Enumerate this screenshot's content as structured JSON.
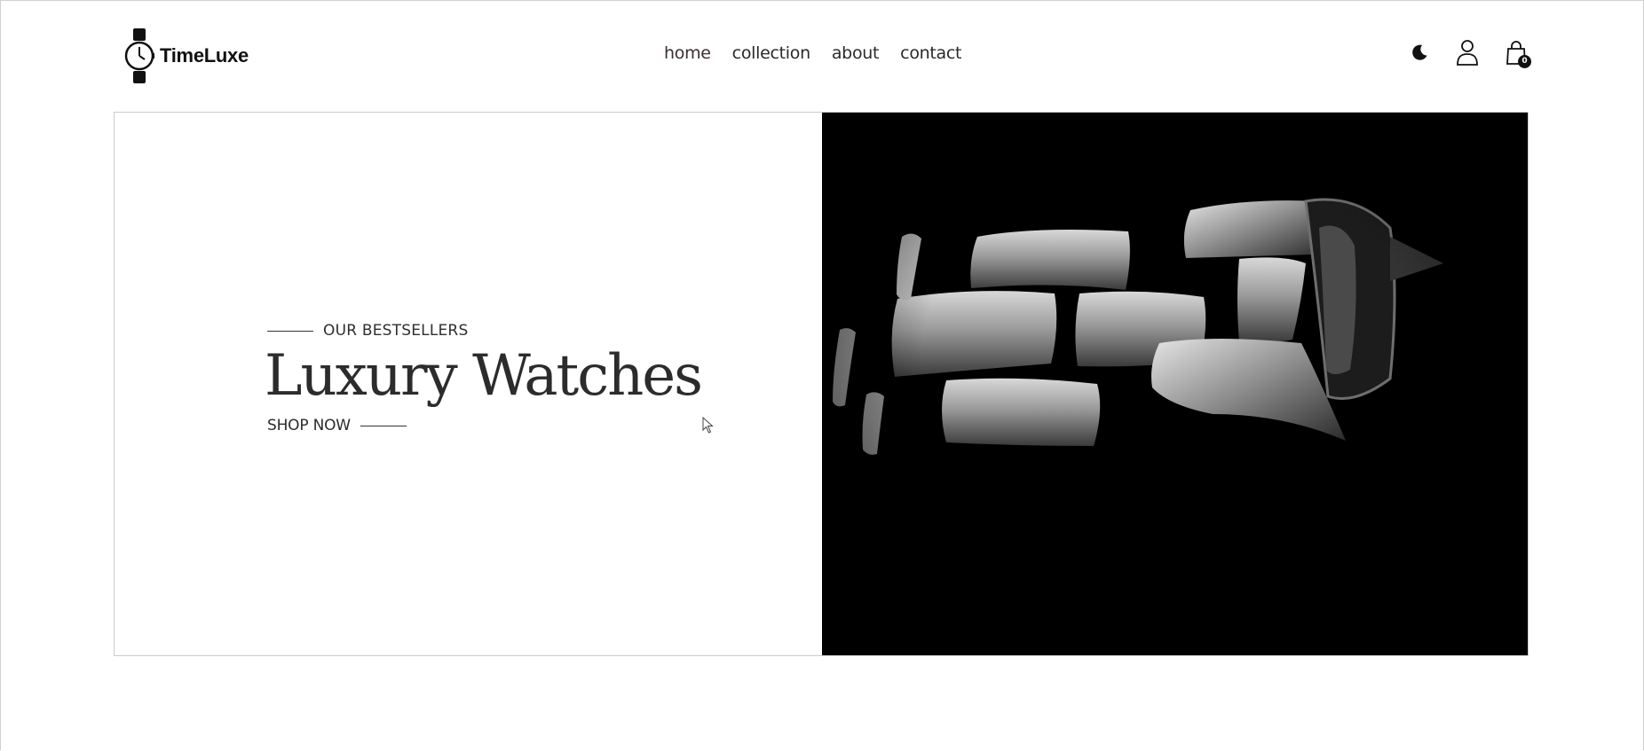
{
  "brand": {
    "name": "TimeLuxe",
    "logo_icon": "wristwatch-icon"
  },
  "nav": {
    "items": [
      {
        "label": "home",
        "active": true
      },
      {
        "label": "collection",
        "active": false
      },
      {
        "label": "about",
        "active": false
      },
      {
        "label": "contact",
        "active": false
      }
    ]
  },
  "header_actions": {
    "theme_icon": "moon-icon",
    "account_icon": "user-icon",
    "cart_icon": "shopping-bag-icon",
    "cart_count": "0"
  },
  "hero": {
    "eyebrow": "OUR BESTSELLERS",
    "title": "Luxury Watches",
    "cta_label": "SHOP NOW",
    "image": "watch-bracelet-closeup"
  },
  "colors": {
    "text": "#1a1a1a",
    "hero_image_bg": "#000000",
    "border": "#cccccc"
  }
}
